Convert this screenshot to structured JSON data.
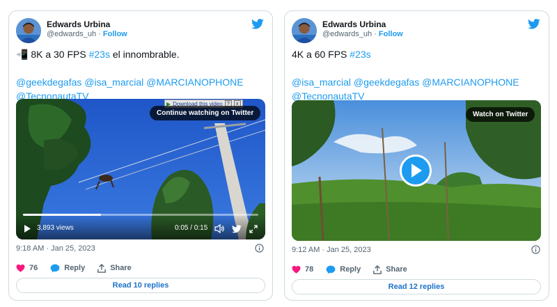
{
  "colors": {
    "accent": "#1d9bf0",
    "like": "#f91880",
    "text": "#0f1419",
    "muted": "#536471"
  },
  "tweets": [
    {
      "author": {
        "name": "Edwards Urbina",
        "handle": "@edwards_uh",
        "follow_label": "Follow"
      },
      "text": {
        "line1_emoji": "📲",
        "line1_text": "8K a 30 FPS ",
        "line1_hashtag": "#23s",
        "line1_tail": " el innombrable.",
        "mentions_line1": "@geekdegafas @isa_marcial @MARCIANOPHONE",
        "mentions_line2": "@TecnonautaTV"
      },
      "video": {
        "download_label": "Download this video",
        "download_help": "?",
        "download_close": "x",
        "overlay_label": "Continue watching on Twitter",
        "views": "3,893 views",
        "time": "0:05 / 0:15",
        "progress": 0.33
      },
      "timestamp": "9:18 AM · Jan 25, 2023",
      "likes": "76",
      "reply_label": "Reply",
      "share_label": "Share",
      "read_replies": "Read 10 replies"
    },
    {
      "author": {
        "name": "Edwards Urbina",
        "handle": "@edwards_uh",
        "follow_label": "Follow"
      },
      "text": {
        "line1_text": "4K a 60 FPS ",
        "line1_hashtag": "#23s",
        "mentions_line1": "@isa_marcial @geekdegafas @MARCIANOPHONE",
        "mentions_line2": "@TecnonautaTV"
      },
      "video": {
        "overlay_label": "Watch on Twitter"
      },
      "timestamp": "9:12 AM · Jan 25, 2023",
      "likes": "78",
      "reply_label": "Reply",
      "share_label": "Share",
      "read_replies": "Read 12 replies"
    }
  ]
}
